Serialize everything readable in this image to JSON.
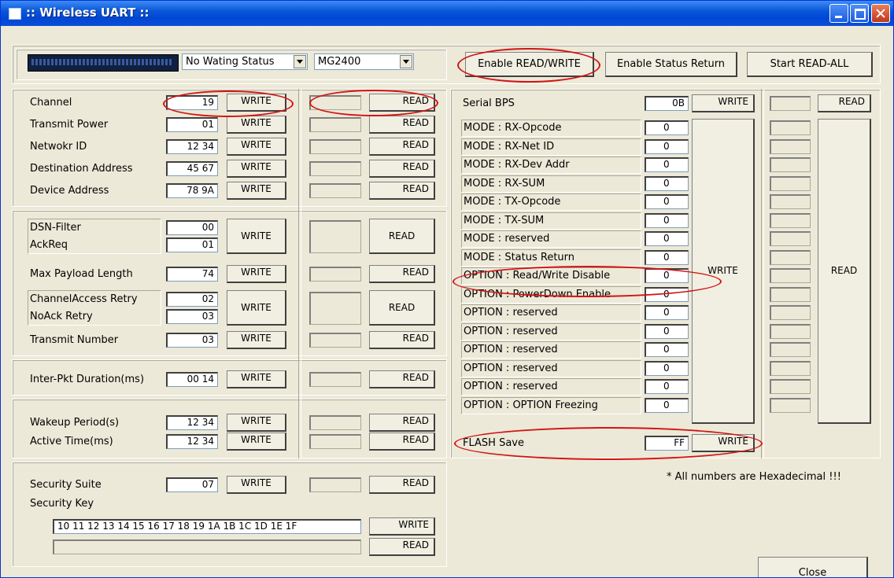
{
  "window": {
    "title": ":: Wireless UART ::"
  },
  "toolbar": {
    "status_select": "No Wating Status",
    "model_select": "MG2400",
    "enable_rw": "Enable READ/WRITE",
    "enable_status": "Enable Status Return",
    "start_read_all": "Start READ-ALL"
  },
  "common": {
    "write": "WRITE",
    "read": "READ"
  },
  "group1": {
    "rows": [
      {
        "label": "Channel",
        "value": "19"
      },
      {
        "label": "Transmit Power",
        "value": "01"
      },
      {
        "label": "Netwokr ID",
        "value": "12 34"
      },
      {
        "label": "Destination Address",
        "value": "45 67"
      },
      {
        "label": "Device Address",
        "value": "78 9A"
      }
    ]
  },
  "group2": {
    "dsn_filter": {
      "label": "DSN-Filter",
      "value": "00"
    },
    "ackreq": {
      "label": "AckReq",
      "value": "01"
    },
    "max_payload": {
      "label": "Max Payload Length",
      "value": "74"
    },
    "ch_access_retry": {
      "label": "ChannelAccess Retry",
      "value": "02"
    },
    "noack_retry": {
      "label": "NoAck Retry",
      "value": "03"
    },
    "transmit_number": {
      "label": "Transmit Number",
      "value": "03"
    }
  },
  "group3": {
    "label": "Inter-Pkt Duration(ms)",
    "value": "00 14"
  },
  "group4": {
    "wakeup": {
      "label": "Wakeup Period(s)",
      "value": "12 34"
    },
    "active": {
      "label": "Active Time(ms)",
      "value": "12 34"
    }
  },
  "group5": {
    "suite": {
      "label": "Security Suite",
      "value": "07"
    },
    "key_label": "Security Key",
    "key_value": "10 11 12 13 14 15 16 17 18 19 1A 1B 1C 1D 1E 1F"
  },
  "right": {
    "serial_bps": {
      "label": "Serial BPS",
      "value": "0B"
    },
    "modes": [
      {
        "label": "MODE : RX-Opcode",
        "value": "0"
      },
      {
        "label": "MODE : RX-Net ID",
        "value": "0"
      },
      {
        "label": "MODE : RX-Dev Addr",
        "value": "0"
      },
      {
        "label": "MODE : RX-SUM",
        "value": "0"
      },
      {
        "label": "MODE : TX-Opcode",
        "value": "0"
      },
      {
        "label": "MODE : TX-SUM",
        "value": "0"
      },
      {
        "label": "MODE : reserved",
        "value": "0"
      },
      {
        "label": "MODE : Status Return",
        "value": "0"
      },
      {
        "label": "OPTION : Read/Write Disable",
        "value": "0"
      },
      {
        "label": "OPTION : PowerDown Enable",
        "value": "0"
      },
      {
        "label": "OPTION : reserved",
        "value": "0"
      },
      {
        "label": "OPTION : reserved",
        "value": "0"
      },
      {
        "label": "OPTION : reserved",
        "value": "0"
      },
      {
        "label": "OPTION : reserved",
        "value": "0"
      },
      {
        "label": "OPTION : reserved",
        "value": "0"
      },
      {
        "label": "OPTION : OPTION Freezing",
        "value": "0"
      }
    ],
    "flash": {
      "label": "FLASH Save",
      "value": "FF"
    },
    "note": "* All numbers are Hexadecimal !!!",
    "close": "Close"
  },
  "colors": {
    "title_bar": "#0054e3",
    "annotation": "#d21414",
    "face": "#ece9d8"
  }
}
